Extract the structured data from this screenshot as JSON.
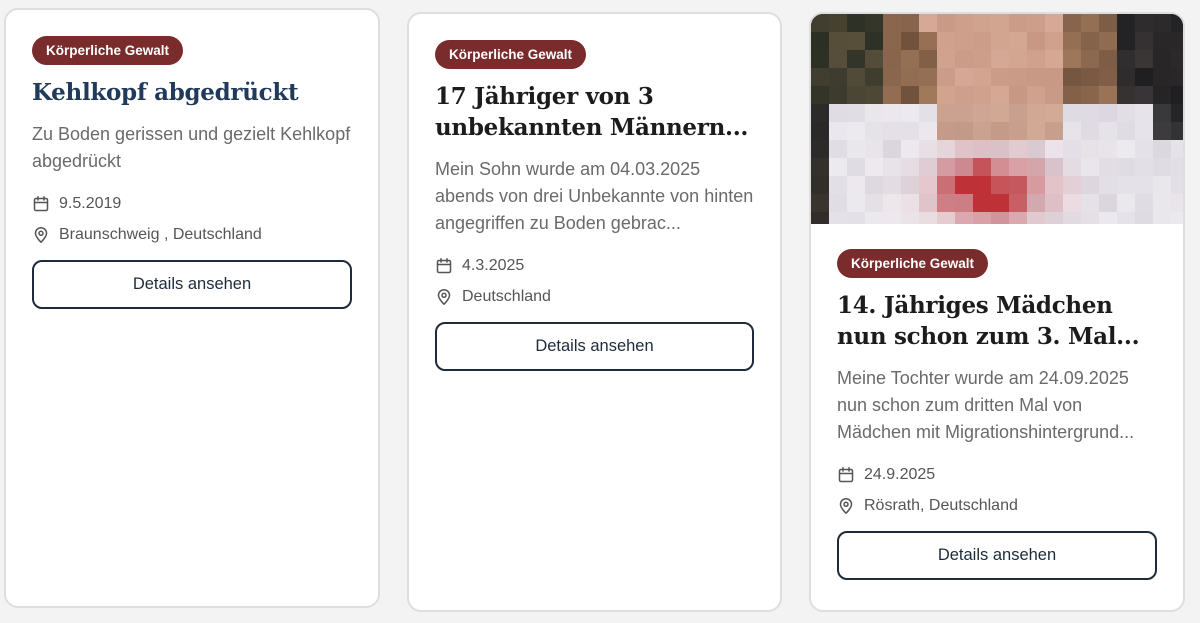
{
  "cards": [
    {
      "badge": "Körperliche Gewalt",
      "title": "Kehlkopf abgedrückt",
      "description": "Zu Boden gerissen und gezielt Kehlkopf abgedrückt",
      "date": "9.5.2019",
      "location": "Braunschweig , Deutschland",
      "button_label": "Details ansehen",
      "has_image": false
    },
    {
      "badge": "Körperliche Gewalt",
      "title": "17 Jähriger von 3 unbekannten Männern...",
      "description": "Mein Sohn wurde am 04.03.2025 abends von drei Unbekannte von hinten angegriffen zu Boden gebrac...",
      "date": "4.3.2025",
      "location": "Deutschland",
      "button_label": "Details ansehen",
      "has_image": false
    },
    {
      "badge": "Körperliche Gewalt",
      "title": "14. Jähriges Mädchen nun schon zum 3. Mal...",
      "description": "Meine Tochter wurde am 24.09.2025 nun schon zum dritten Mal von Mädchen mit Migrationshintergrund...",
      "date": "24.9.2025",
      "location": "Rösrath, Deutschland",
      "button_label": "Details ansehen",
      "has_image": true
    }
  ],
  "icons": {
    "date": "calendar-icon",
    "location": "map-pin-icon"
  },
  "colors": {
    "badge_background": "#7a2b2b",
    "badge_text": "#ffffff",
    "button_border": "#1d2b3a",
    "title_card_1": "#1f3a5a",
    "title_default": "#1c1c1c",
    "description_text": "#6a6a6a",
    "meta_text": "#555555",
    "page_background": "#f3f3f3"
  }
}
